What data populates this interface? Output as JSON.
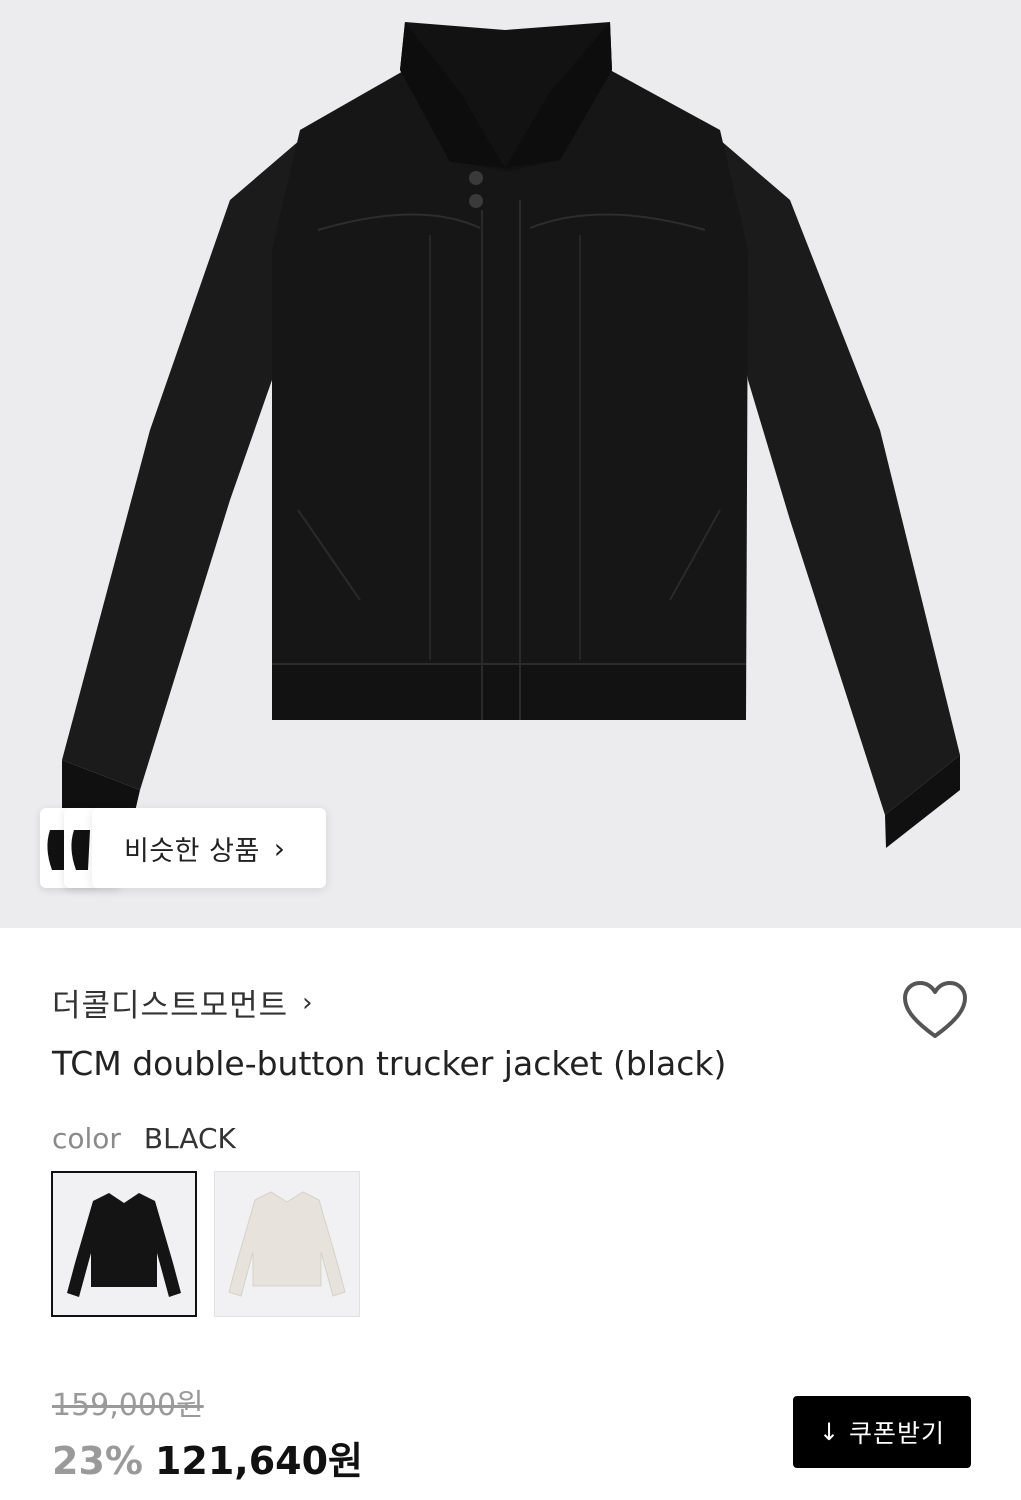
{
  "gallery": {
    "image_icon": "black-jacket-photo",
    "similar_products": {
      "label": "비슷한 상품",
      "chevron": "›"
    }
  },
  "product": {
    "brand": "더콜디스트모먼트",
    "brand_chevron": "›",
    "title": "TCM double-button trucker jacket (black)",
    "wishlist_icon": "heart-icon"
  },
  "options": {
    "color_key": "color",
    "color_value": "BLACK",
    "swatches": [
      {
        "name": "black",
        "selected": true
      },
      {
        "name": "ivory",
        "selected": false
      }
    ]
  },
  "pricing": {
    "original": "159,000원",
    "discount": "23%",
    "final": "121,640원"
  },
  "coupon": {
    "label": "쿠폰받기",
    "icon": "↓"
  },
  "colors": {
    "accent": "#000000",
    "muted": "#9a9a9a",
    "bg": "#ececee"
  }
}
